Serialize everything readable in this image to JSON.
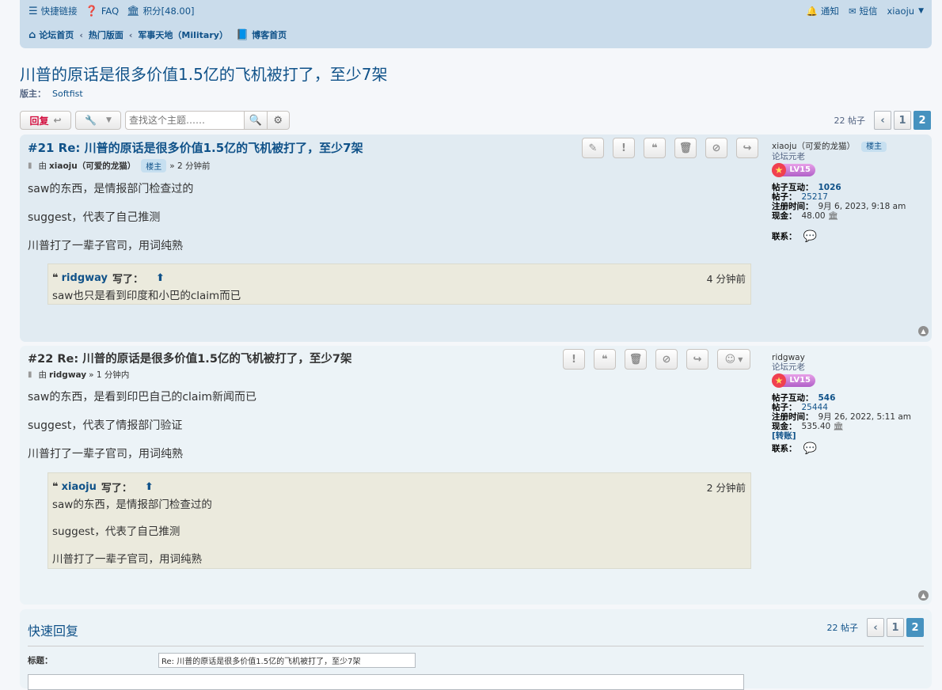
{
  "nav": {
    "quick_links": "快捷链接",
    "faq": "FAQ",
    "points": "积分[48.00]",
    "notifications": "通知",
    "messages": "短信",
    "username": "xiaoju",
    "breadcrumbs": [
      "论坛首页",
      "热门版面",
      "军事天地（Military）",
      "博客首页"
    ]
  },
  "topic": {
    "title": "川普的原话是很多价值1.5亿的飞机被打了，至少7架",
    "moderators_label": "版主：",
    "moderator": "Softfist",
    "reply_label": "回复",
    "search_placeholder": "查找这个主题……",
    "post_count": "22 帖子",
    "pages": [
      "1",
      "2"
    ]
  },
  "posts": [
    {
      "title": "#21 Re: 川普的原话是很多价值1.5亿的飞机被打了，至少7架",
      "by": "由",
      "author": "xiaoju（可爱的龙猫）",
      "op_badge": "楼主",
      "time": "» 2 分钟前",
      "lines": [
        "saw的东西，是情报部门检查过的",
        "suggest，代表了自己推测",
        "川普打了一辈子官司，用词纯熟"
      ],
      "quote": {
        "author": "ridgway",
        "wrote": "写了：",
        "time": "4 分钟前",
        "lines": [
          "saw也只是看到印度和小巴的claim而已"
        ]
      },
      "profile": {
        "name": "xiaoju（可爱的龙猫）",
        "badge": "楼主",
        "rank": "论坛元老",
        "level": "LV15",
        "interact_label": "帖子互动：",
        "interact": "1026",
        "posts_label": "帖子：",
        "posts": "25217",
        "joined_label": "注册时间：",
        "joined": "9月 6, 2023, 9:18 am",
        "cash_label": "现金：",
        "cash": "48.00",
        "contact_label": "联系："
      }
    },
    {
      "title": "#22 Re: 川普的原话是很多价值1.5亿的飞机被打了，至少7架",
      "by": "由",
      "author": "ridgway",
      "time": "» 1 分钟内",
      "lines": [
        "saw的东西，是看到印巴自己的claim新闻而已",
        "suggest，代表了情报部门验证",
        "川普打了一辈子官司，用词纯熟"
      ],
      "quote": {
        "author": "xiaoju",
        "wrote": "写了：",
        "time": "2 分钟前",
        "lines": [
          "saw的东西，是情报部门检查过的",
          "suggest，代表了自己推测",
          "川普打了一辈子官司，用词纯熟"
        ]
      },
      "profile": {
        "name": "ridgway",
        "rank": "论坛元老",
        "level": "LV15",
        "interact_label": "帖子互动：",
        "interact": "546",
        "posts_label": "帖子：",
        "posts": "25444",
        "joined_label": "注册时间：",
        "joined": "9月 26, 2022, 5:11 am",
        "cash_label": "现金：",
        "cash": "535.40",
        "transfer": "[转账]",
        "contact_label": "联系："
      }
    }
  ],
  "quick_reply": {
    "heading": "快速回复",
    "post_count": "22 帖子",
    "subject_label": "标题：",
    "subject_value": "Re: 川普的原话是很多价值1.5亿的飞机被打了，至少7架"
  }
}
